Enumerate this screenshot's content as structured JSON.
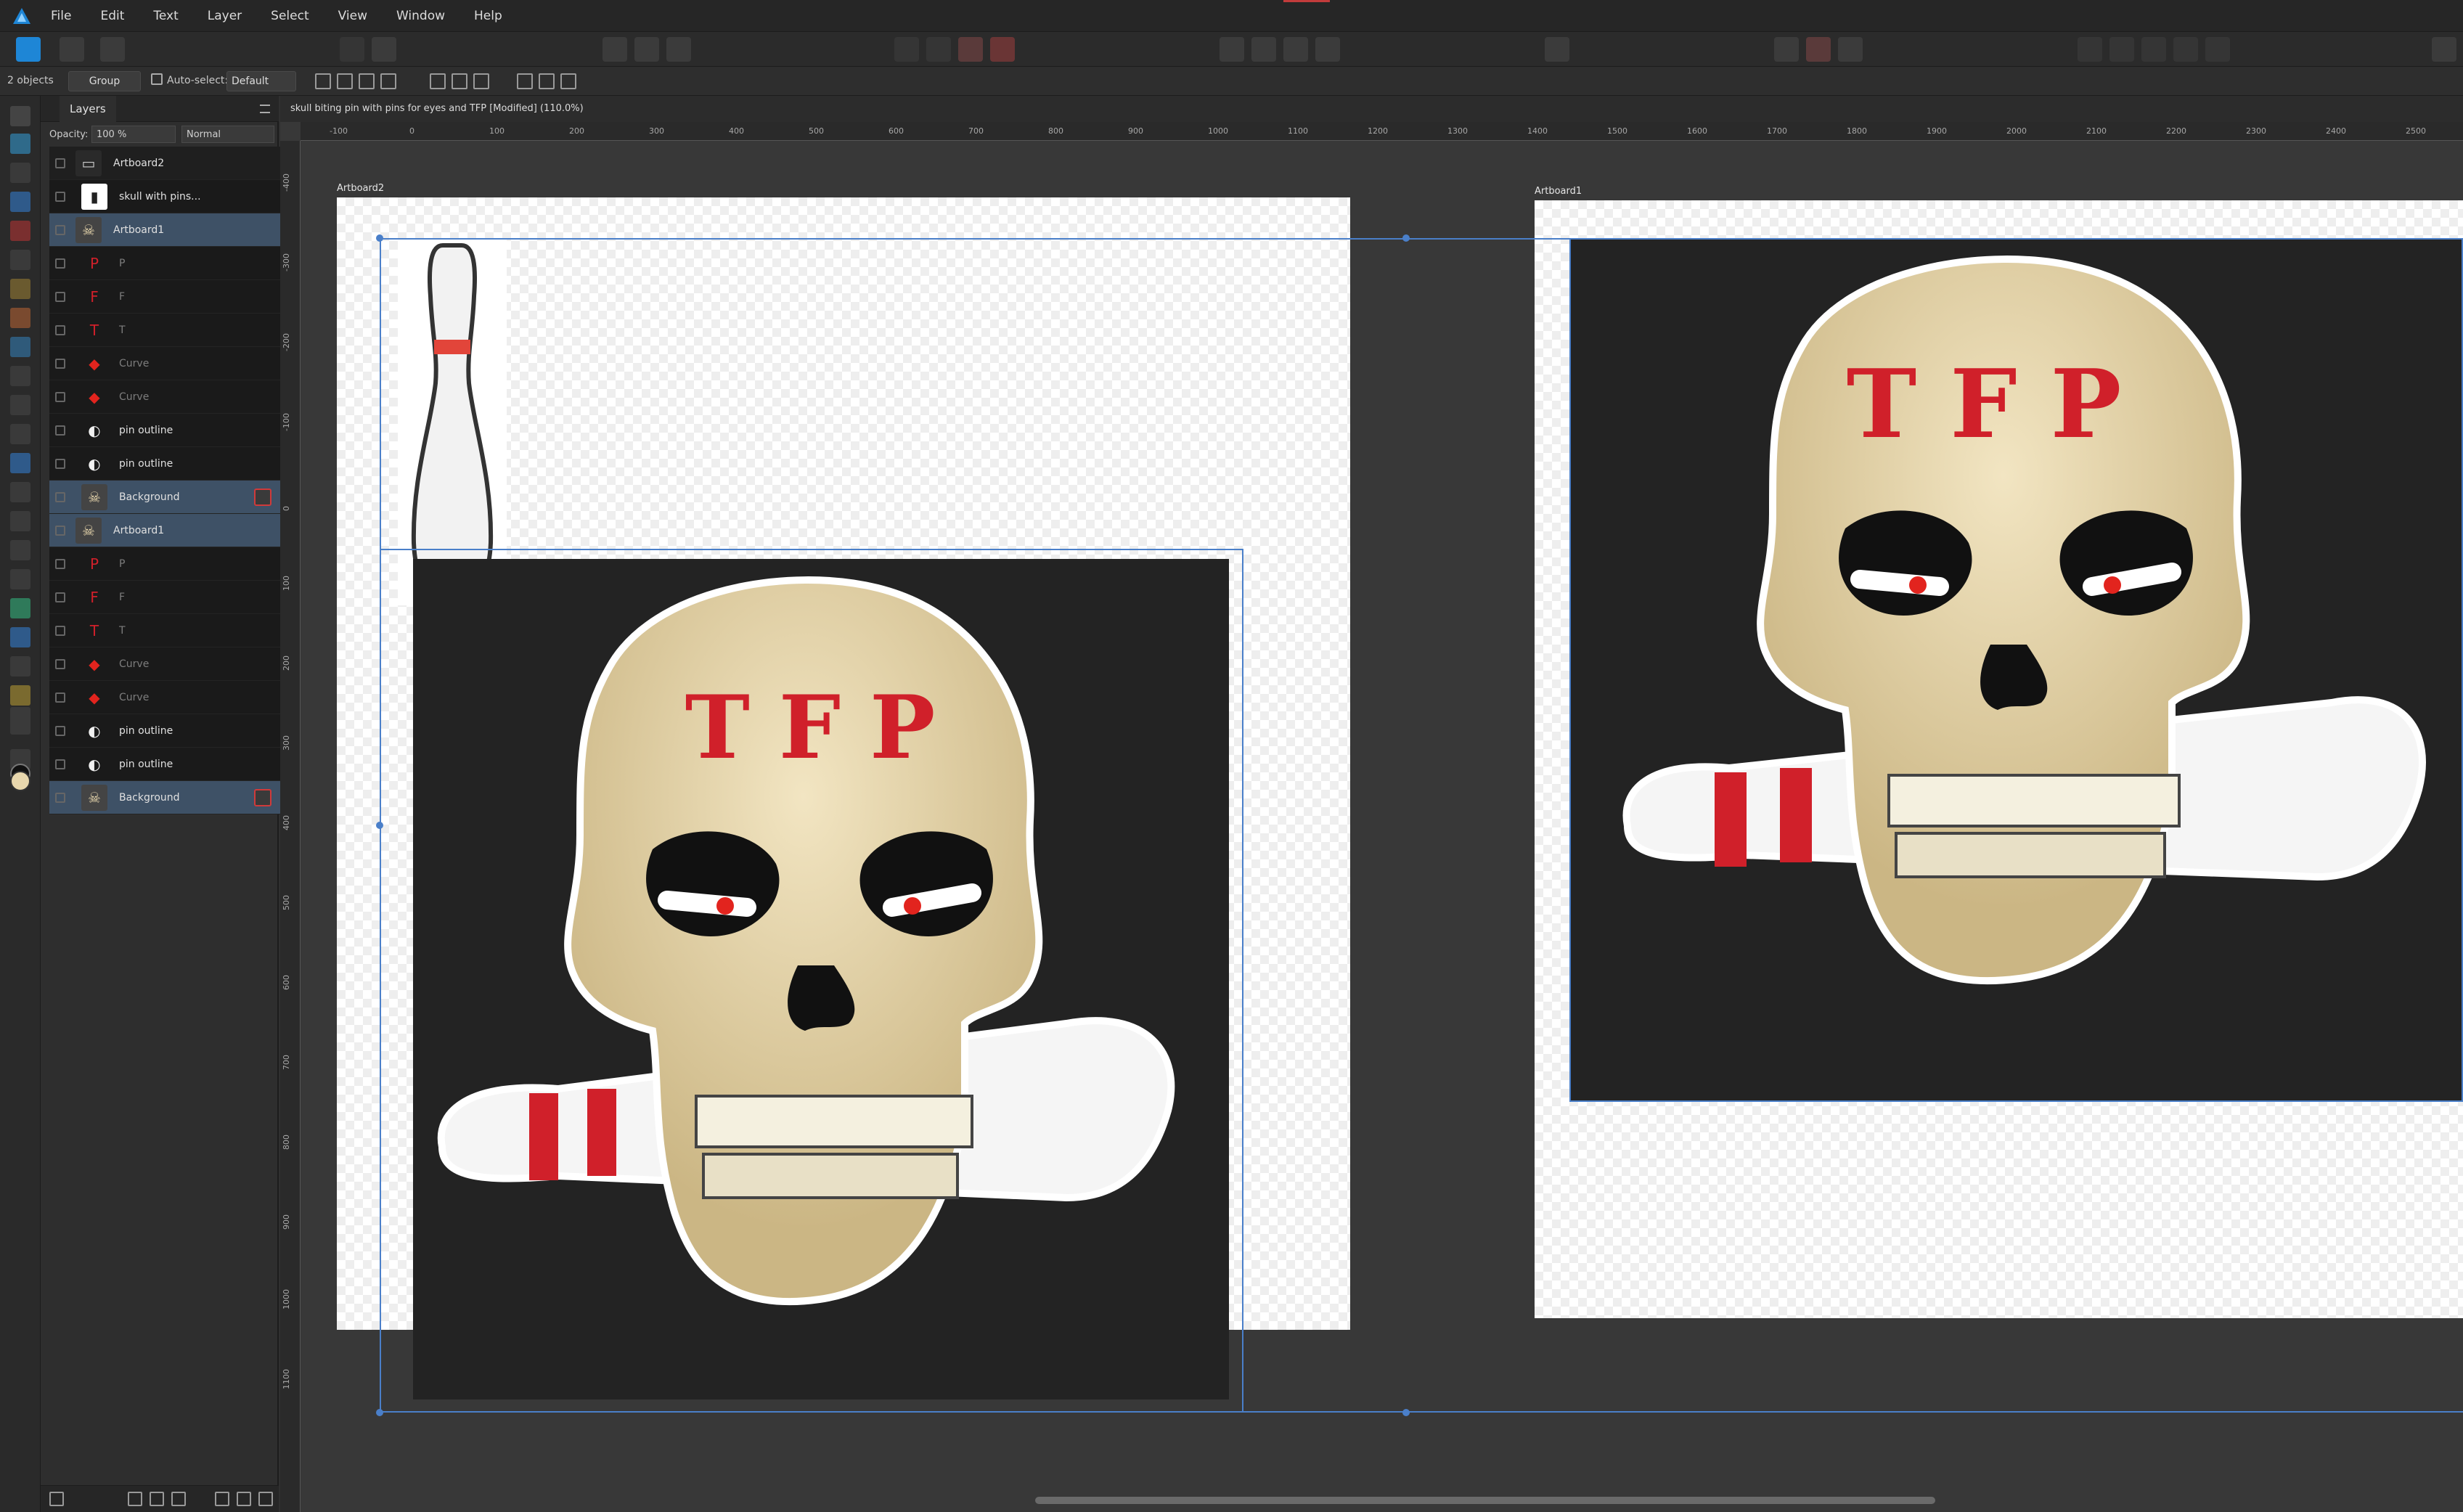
{
  "menu": {
    "items": [
      "File",
      "Edit",
      "Text",
      "Layer",
      "Select",
      "View",
      "Window",
      "Help"
    ]
  },
  "context": {
    "selection_count": "2 objects",
    "group_label": "Group",
    "autoselect_label": "Auto-select:",
    "autoselect_value": "Default"
  },
  "layers_panel": {
    "tab_label": "Layers",
    "opacity_label": "Opacity:",
    "opacity_value": "100 %",
    "blend_mode": "Normal",
    "rows": [
      {
        "label": "Artboard2",
        "thumb": "artboard",
        "indent": 0,
        "selected": false,
        "dim": false
      },
      {
        "label": "skull with pins...",
        "thumb": "pin",
        "indent": 1,
        "selected": false,
        "dim": false
      },
      {
        "label": "Artboard1",
        "thumb": "skull",
        "indent": 0,
        "selected": true,
        "dim": false
      },
      {
        "label": "P",
        "thumb": "letter-p",
        "indent": 1,
        "selected": false,
        "dim": true
      },
      {
        "label": "F",
        "thumb": "letter-f",
        "indent": 1,
        "selected": false,
        "dim": true
      },
      {
        "label": "T",
        "thumb": "letter-t",
        "indent": 1,
        "selected": false,
        "dim": true
      },
      {
        "label": "Curve",
        "thumb": "red-shape",
        "indent": 1,
        "selected": false,
        "dim": true
      },
      {
        "label": "Curve",
        "thumb": "red-shape",
        "indent": 1,
        "selected": false,
        "dim": true
      },
      {
        "label": "pin outline",
        "thumb": "pin-outline",
        "indent": 1,
        "selected": false,
        "dim": false
      },
      {
        "label": "pin outline",
        "thumb": "pin-outline",
        "indent": 1,
        "selected": false,
        "dim": false
      },
      {
        "label": "Background",
        "thumb": "skull",
        "indent": 1,
        "selected": true,
        "dim": false,
        "fx": true
      },
      {
        "label": "Artboard1",
        "thumb": "skull",
        "indent": 0,
        "selected": true,
        "dim": false
      },
      {
        "label": "P",
        "thumb": "letter-p",
        "indent": 1,
        "selected": false,
        "dim": true
      },
      {
        "label": "F",
        "thumb": "letter-f",
        "indent": 1,
        "selected": false,
        "dim": true
      },
      {
        "label": "T",
        "thumb": "letter-t",
        "indent": 1,
        "selected": false,
        "dim": true
      },
      {
        "label": "Curve",
        "thumb": "red-shape",
        "indent": 1,
        "selected": false,
        "dim": true
      },
      {
        "label": "Curve",
        "thumb": "red-shape",
        "indent": 1,
        "selected": false,
        "dim": true
      },
      {
        "label": "pin outline",
        "thumb": "pin-outline",
        "indent": 1,
        "selected": false,
        "dim": false
      },
      {
        "label": "pin outline",
        "thumb": "pin-outline",
        "indent": 1,
        "selected": false,
        "dim": false
      },
      {
        "label": "Background",
        "thumb": "skull",
        "indent": 1,
        "selected": true,
        "dim": false,
        "fx": true
      }
    ]
  },
  "document": {
    "title": "skull biting pin with pins for eyes and TFP [Modified] (110.0%)",
    "artboard_left_label": "Artboard2",
    "artboard_right_label": "Artboard1",
    "forehead_text": "TFP"
  },
  "rulers": {
    "h_ticks": [
      "-100",
      "0",
      "100",
      "200",
      "300",
      "400",
      "500",
      "600",
      "700",
      "800",
      "900",
      "1000",
      "1100",
      "1200",
      "1300",
      "1400",
      "1500",
      "1600",
      "1700",
      "1800",
      "1900",
      "2000",
      "2100",
      "2200",
      "2300",
      "2400",
      "2500"
    ],
    "v_ticks": [
      "-400",
      "-300",
      "-200",
      "-100",
      "0",
      "100",
      "200",
      "300",
      "400",
      "500",
      "600",
      "700",
      "800",
      "900",
      "1000",
      "1100"
    ]
  },
  "colors": {
    "accent": "#4a7fc9",
    "brand": "#1e86d6",
    "skull_bone": "#e8d7ad",
    "stripe_red": "#d0202a",
    "artwork_bg": "#232323"
  }
}
